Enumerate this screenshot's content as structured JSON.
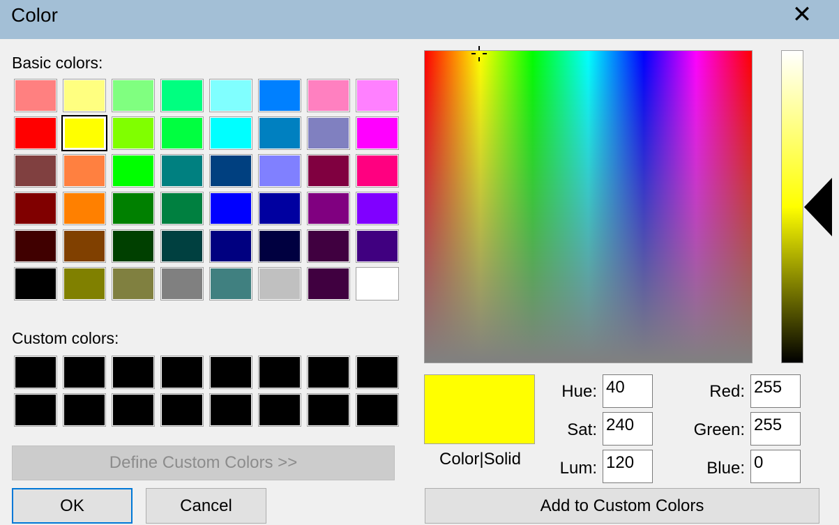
{
  "window": {
    "title": "Color",
    "close_glyph": "✕"
  },
  "basic_colors": {
    "label": "Basic colors:",
    "rows": [
      [
        "#ff8080",
        "#ffff80",
        "#80ff80",
        "#00ff80",
        "#80ffff",
        "#0080ff",
        "#ff80c0",
        "#ff80ff"
      ],
      [
        "#ff0000",
        "#ffff00",
        "#80ff00",
        "#00ff40",
        "#00ffff",
        "#0080c0",
        "#8080c0",
        "#ff00ff"
      ],
      [
        "#804040",
        "#ff8040",
        "#00ff00",
        "#008080",
        "#004080",
        "#8080ff",
        "#800040",
        "#ff0080"
      ],
      [
        "#800000",
        "#ff8000",
        "#008000",
        "#008040",
        "#0000ff",
        "#0000a0",
        "#800080",
        "#8000ff"
      ],
      [
        "#400000",
        "#804000",
        "#004000",
        "#004040",
        "#000080",
        "#000040",
        "#400040",
        "#400080"
      ],
      [
        "#000000",
        "#808000",
        "#808040",
        "#808080",
        "#408080",
        "#c0c0c0",
        "#400040",
        "#ffffff"
      ]
    ],
    "selected": {
      "row": 1,
      "col": 1
    }
  },
  "custom_colors": {
    "label": "Custom colors:",
    "rows": [
      [
        "#000000",
        "#000000",
        "#000000",
        "#000000",
        "#000000",
        "#000000",
        "#000000",
        "#000000"
      ],
      [
        "#000000",
        "#000000",
        "#000000",
        "#000000",
        "#000000",
        "#000000",
        "#000000",
        "#000000"
      ]
    ]
  },
  "buttons": {
    "define_custom": "Define Custom Colors >>",
    "ok": "OK",
    "cancel": "Cancel",
    "add_custom": "Add to Custom Colors"
  },
  "current": {
    "preview_color": "#ffff00",
    "preview_label": "Color|Solid",
    "hue_label": "Hue:",
    "hue": "40",
    "sat_label": "Sat:",
    "sat": "240",
    "lum_label": "Lum:",
    "lum": "120",
    "red_label": "Red:",
    "red": "255",
    "green_label": "Green:",
    "green": "255",
    "blue_label": "Blue:",
    "blue": "0"
  }
}
